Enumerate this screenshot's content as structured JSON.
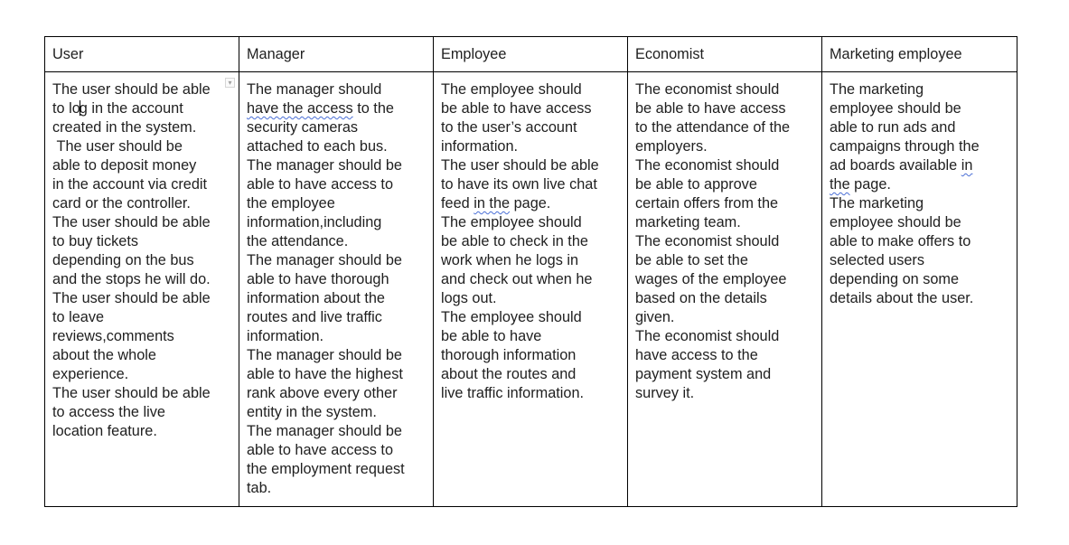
{
  "table": {
    "headers": [
      "User",
      "Manager",
      "Employee",
      "Economist",
      "Marketing employee"
    ],
    "columns": [
      {
        "lines": [
          "The user should be able",
          "to log in the account",
          "created in the system.",
          " The user should be",
          "able to deposit money",
          "in the account via credit",
          "card or the controller.",
          "The user should be able",
          "to buy tickets",
          "depending on the bus",
          "and the stops he will do.",
          "The user should be able",
          "to leave",
          "reviews,comments",
          "about the whole",
          "experience.",
          "The user should be able",
          "to access the live",
          "location feature."
        ]
      },
      {
        "lines": [
          "The manager should",
          "have the access to the",
          "security cameras",
          "attached to each bus.",
          "The manager should be",
          "able to have access to",
          "the employee",
          "information,including",
          "the attendance.",
          "The manager should be",
          "able to have thorough",
          "information about the",
          "routes and live traffic",
          "information.",
          "The manager should be",
          "able to have the highest",
          "rank above every other",
          "entity in the system.",
          "The manager should be",
          "able to have access to",
          "the employment request",
          "tab."
        ]
      },
      {
        "lines": [
          "The employee should",
          "be able to have access",
          "to the user’s account",
          "information.",
          "The user should be able",
          "to have its own live chat",
          "feed in the page.",
          "The employee should",
          "be able to check in the",
          "work when he logs in",
          "and check out when he",
          "logs out.",
          "The employee should",
          "be able to have",
          "thorough information",
          "about the routes and",
          "live traffic information."
        ]
      },
      {
        "lines": [
          "The economist should",
          "be able to have access",
          "to the attendance of the",
          "employers.",
          "The economist should",
          "be able to approve",
          "certain offers from the",
          "marketing team.",
          "The economist should",
          "be able to set the",
          "wages of the employee",
          "based on the details",
          "given.",
          "The economist should",
          "have access to the",
          "payment system and",
          "survey it."
        ]
      },
      {
        "lines": [
          "The marketing",
          "employee should be",
          "able to run ads and",
          "campaigns through the",
          "ad boards available in",
          "the page.",
          "The marketing",
          "employee should be",
          "able to make offers to",
          "selected users",
          "depending on some",
          "details about the user."
        ]
      }
    ],
    "spellcheck_marks": [
      {
        "column": 1,
        "line": 1,
        "text": "have the access"
      },
      {
        "column": 2,
        "line": 6,
        "text": "in the"
      },
      {
        "column": 4,
        "line": 4,
        "text": "in"
      },
      {
        "column": 4,
        "line": 5,
        "text": "the"
      }
    ],
    "cell_menu_icon": "dropdown-arrow-icon",
    "cursor": {
      "column": 0,
      "line": 1,
      "after_text": "to lo"
    }
  },
  "colors": {
    "border": "#000000",
    "text": "#1f1f1f",
    "spellcheck_underline": "#4a6fd6"
  }
}
